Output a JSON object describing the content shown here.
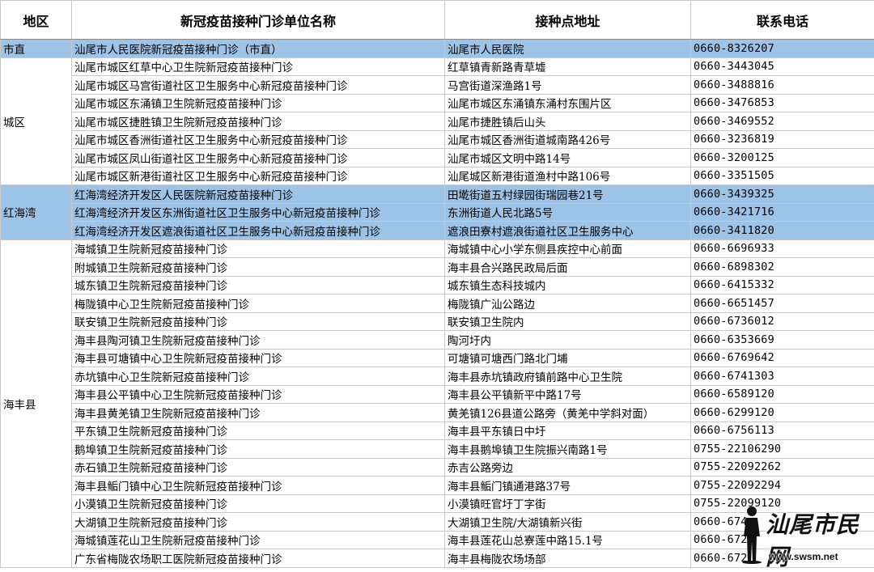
{
  "headers": {
    "region": "地区",
    "name": "新冠疫苗接种门诊单位名称",
    "address": "接种点地址",
    "phone": "联系电话"
  },
  "groups": [
    {
      "region": "市直",
      "highlight": true,
      "rows": [
        {
          "name": "汕尾市人民医院新冠疫苗接种门诊（市直）",
          "address": "汕尾市人民医院",
          "phone": "0660-8326207"
        }
      ]
    },
    {
      "region": "城区",
      "highlight": false,
      "rows": [
        {
          "name": "汕尾市城区红草中心卫生院新冠疫苗接种门诊",
          "address": "红草镇青新路青草墟",
          "phone": "0660-3443045"
        },
        {
          "name": "汕尾市城区马宫街道社区卫生服务中心新冠疫苗接种门诊",
          "address": "马宫街道深渔路1号",
          "phone": "0660-3488816"
        },
        {
          "name": "汕尾市城区东涌镇卫生院新冠疫苗接种门诊",
          "address": "汕尾市城区东涌镇东涌村东围片区",
          "phone": "0660-3476853"
        },
        {
          "name": "汕尾市城区捷胜镇卫生院新冠疫苗接种门诊",
          "address": "汕尾市捷胜镇后山头",
          "phone": "0660-3469552"
        },
        {
          "name": "汕尾市城区香洲街道社区卫生服务中心新冠疫苗接种门诊",
          "address": "汕尾市城区香洲街道城南路426号",
          "phone": "0660-3236819"
        },
        {
          "name": "汕尾市城区凤山街道社区卫生服务中心新冠疫苗接种门诊",
          "address": "汕尾市城区文明中路14号",
          "phone": "0660-3200125"
        },
        {
          "name": "汕尾市城区新港街道社区卫生服务中心新冠疫苗接种门诊",
          "address": "汕尾城区新港街道渔村中路106号",
          "phone": "0660-3351505"
        }
      ]
    },
    {
      "region": "红海湾",
      "highlight": true,
      "rows": [
        {
          "name": "红海湾经济开发区人民医院新冠疫苗接种门诊",
          "address": "田墘街道五村绿园街瑞园巷21号",
          "phone": "0660-3439325"
        },
        {
          "name": "红海湾经济开发区东洲街道社区卫生服务中心新冠疫苗接种门诊",
          "address": "东洲街道人民北路5号",
          "phone": "0660-3421716"
        },
        {
          "name": "红海湾经济开发区遮浪街道社区卫生服务中心新冠疫苗接种门诊",
          "address": "遮浪田寮村遮浪街道社区卫生服务中心",
          "phone": "0660-3411820"
        }
      ]
    },
    {
      "region": "海丰县",
      "highlight": false,
      "rows": [
        {
          "name": "海城镇卫生院新冠疫苗接种门诊",
          "address": "海城镇中心小学东侧县疾控中心前面",
          "phone": "0660-6696933"
        },
        {
          "name": "附城镇卫生院新冠疫苗接种门诊",
          "address": "海丰县合兴路民政局后面",
          "phone": "0660-6898302"
        },
        {
          "name": "城东镇卫生院新冠疫苗接种门诊",
          "address": "城东镇生态科技城内",
          "phone": "0660-6415332"
        },
        {
          "name": "梅陇镇中心卫生院新冠疫苗接种门诊",
          "address": "梅陇镇广汕公路边",
          "phone": "0660-6651457"
        },
        {
          "name": "联安镇卫生院新冠疫苗接种门诊",
          "address": "联安镇卫生院内",
          "phone": "0660-6736012"
        },
        {
          "name": "海丰县陶河镇卫生院新冠疫苗接种门诊",
          "address": "陶河圩内",
          "phone": "0660-6353669"
        },
        {
          "name": "海丰县可塘镇中心卫生院新冠疫苗接种门诊",
          "address": "可塘镇可塘西门路北门埔",
          "phone": "0660-6769642"
        },
        {
          "name": "赤坑镇中心卫生院新冠疫苗接种门诊",
          "address": "海丰县赤坑镇政府镇前路中心卫生院",
          "phone": "0660-6741303"
        },
        {
          "name": "海丰县公平镇中心卫生院新冠疫苗接种门诊",
          "address": "海丰县公平镇新平中路17号",
          "phone": "0660-6589120"
        },
        {
          "name": "海丰县黄羌镇卫生院新冠疫苗接种门诊",
          "address": "黄羌镇126县道公路旁（黄羌中学斜对面）",
          "phone": "0660-6299120"
        },
        {
          "name": "平东镇卫生院新冠疫苗接种门诊",
          "address": "海丰县平东镇日中圩",
          "phone": "0660-6756113"
        },
        {
          "name": "鹅埠镇卫生院新冠疫苗接种门诊",
          "address": "海丰县鹅埠镇卫生院振兴南路1号",
          "phone": "0755-22106290"
        },
        {
          "name": "赤石镇卫生院新冠疫苗接种门诊",
          "address": "赤吉公路旁边",
          "phone": "0755-22092262"
        },
        {
          "name": "海丰县鲘门镇中心卫生院新冠疫苗接种门诊",
          "address": "海丰县鲘门镇通港路37号",
          "phone": "0755-22092294"
        },
        {
          "name": "小漠镇卫生院新冠疫苗接种门诊",
          "address": "小漠镇旺官圩丁字街",
          "phone": "0755-22099120"
        },
        {
          "name": "大湖镇卫生院新冠疫苗接种门诊",
          "address": "大湖镇卫生院/大湖镇新兴街",
          "phone": "0660-674"
        },
        {
          "name": "海城镇莲花山卫生院新冠疫苗接种门诊",
          "address": "海丰县莲花山总寮莲中路15.1号",
          "phone": "0660-6729"
        },
        {
          "name": "广东省梅陇农场职工医院新冠疫苗接种门诊",
          "address": "海丰县梅陇农场场部",
          "phone": "0660-672"
        }
      ]
    }
  ],
  "watermark": {
    "brand": "汕尾市民网",
    "url": "www.swsm.net"
  }
}
